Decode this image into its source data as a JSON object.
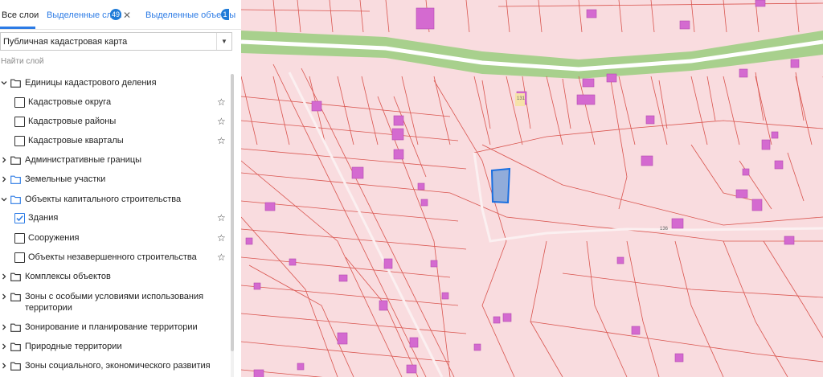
{
  "tabs": {
    "all_layers": "Все слои",
    "selected_layers": "Выделенные слои",
    "selected_layers_count": "49",
    "selected_objects": "Выделенные объекты",
    "selected_objects_count": "1"
  },
  "basemap": {
    "value": "Публичная кадастровая карта"
  },
  "search": {
    "placeholder": "Найти слой"
  },
  "layers": [
    {
      "label": "Единицы кадастрового деления",
      "kind": "group",
      "expanded": true,
      "icon": "folder-outline-icon"
    },
    {
      "label": "Кадастровые округа",
      "kind": "item",
      "checked": false
    },
    {
      "label": "Кадастровые районы",
      "kind": "item",
      "checked": false
    },
    {
      "label": "Кадастровые кварталы",
      "kind": "item",
      "checked": false
    },
    {
      "label": "Административные границы",
      "kind": "group",
      "expanded": false,
      "icon": "folder-outline-icon"
    },
    {
      "label": "Земельные участки",
      "kind": "group",
      "expanded": false,
      "icon": "folder-blue-icon"
    },
    {
      "label": "Объекты капитального строительства",
      "kind": "group",
      "expanded": true,
      "icon": "folder-blue-icon"
    },
    {
      "label": "Здания",
      "kind": "item",
      "checked": true
    },
    {
      "label": "Сооружения",
      "kind": "item",
      "checked": false
    },
    {
      "label": "Объекты незавершенного строительства",
      "kind": "item",
      "checked": false
    },
    {
      "label": "Комплексы объектов",
      "kind": "group",
      "expanded": false,
      "icon": "folder-outline-icon"
    },
    {
      "label_line1": "Зоны с особыми условиями использования",
      "label_line2": "территории",
      "kind": "group",
      "expanded": false,
      "icon": "folder-outline-icon"
    },
    {
      "label": "Зонирование и планирование территории",
      "kind": "group",
      "expanded": false,
      "icon": "folder-outline-icon"
    },
    {
      "label": "Природные территории",
      "kind": "group",
      "expanded": false,
      "icon": "folder-outline-icon"
    },
    {
      "label": "Зоны социального, экономического развития",
      "kind": "group",
      "expanded": false,
      "icon": "folder-outline-icon"
    }
  ],
  "map": {
    "labels": [
      "131",
      "136"
    ],
    "colors": {
      "parcel_fill": "#f9dcdf",
      "parcel_border": "#d9554f",
      "building": "#d46ad0",
      "green_strip": "#a8d08d",
      "selected_fill": "#7fa3d9",
      "selected_border": "#1a6fe0",
      "accent": "#2c7be5"
    }
  }
}
